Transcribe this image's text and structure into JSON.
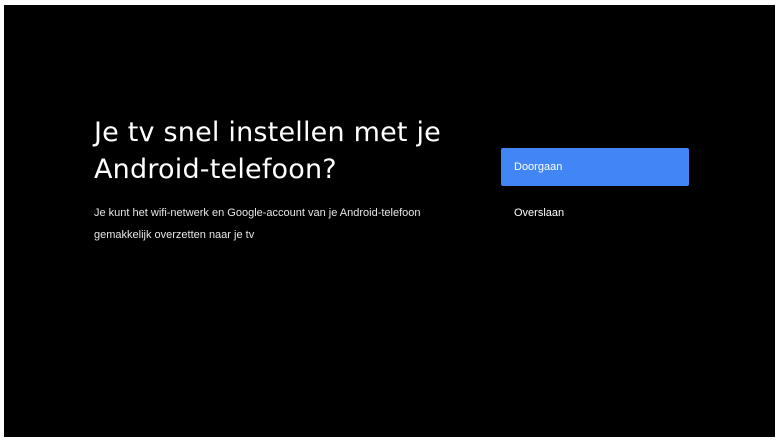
{
  "screen": {
    "title_lines": [
      "Je tv snel instellen met je",
      "Android-telefoon?"
    ],
    "description_lines": [
      "Je kunt het wifi-netwerk en Google-account van je Android-telefoon",
      "gemakkelijk overzetten naar je tv"
    ],
    "options": [
      {
        "label": "Doorgaan"
      },
      {
        "label": "Overslaan"
      }
    ]
  },
  "colors": {
    "background": "#000000",
    "accent": "#4285f4",
    "text": "#ffffff"
  }
}
